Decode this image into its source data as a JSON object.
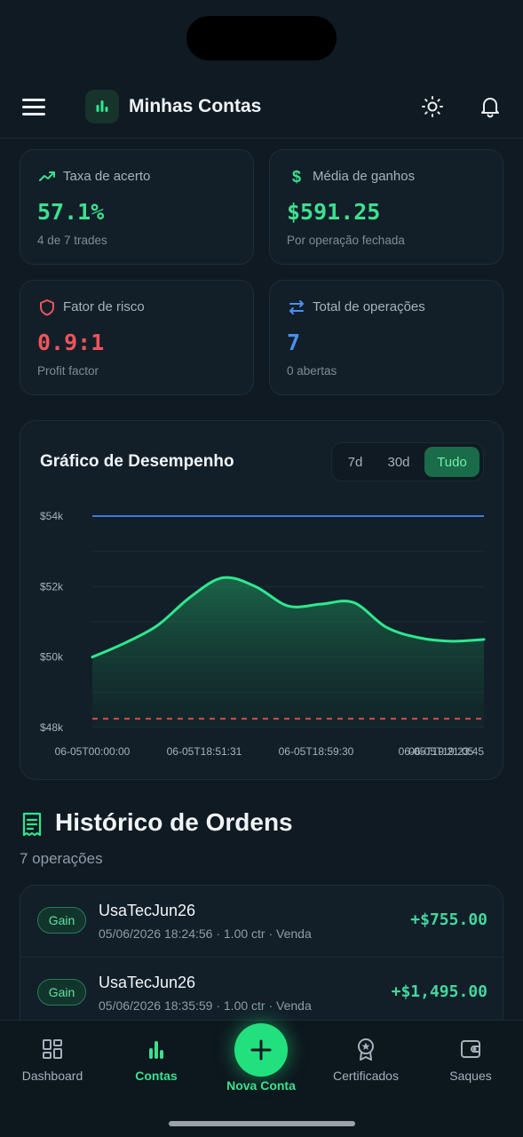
{
  "header": {
    "title": "Minhas Contas"
  },
  "stats": [
    {
      "label": "Taxa de acerto",
      "value": "57.1%",
      "sub": "4 de 7 trades",
      "color": "#3ee08e",
      "icon": "trend-up-icon"
    },
    {
      "label": "Média de ganhos",
      "value": "$591.25",
      "sub": "Por operação fechada",
      "color": "#3ee08e",
      "icon": "dollar-icon"
    },
    {
      "label": "Fator de risco",
      "value": "0.9:1",
      "sub": "Profit factor",
      "color": "#f0545a",
      "icon": "shield-icon"
    },
    {
      "label": "Total de operações",
      "value": "7",
      "sub": "0 abertas",
      "color": "#4a8ff0",
      "icon": "arrows-swap-icon"
    }
  ],
  "chart_card": {
    "title": "Gráfico de Desempenho",
    "ranges": [
      "7d",
      "30d",
      "Tudo"
    ],
    "active_range": "Tudo"
  },
  "chart_data": {
    "type": "area",
    "y_ticks": [
      "$54k",
      "$52k",
      "$50k",
      "$48k"
    ],
    "ylim": [
      48000,
      54000
    ],
    "x_ticks": [
      "06-05T00:00:00",
      "06-05T18:51:31",
      "06-05T18:59:30",
      "06-05T19:21:05",
      "06-05T19:23:45"
    ],
    "series": [
      {
        "values": [
          50000,
          50400,
          50900,
          51700,
          52250,
          52000,
          51450,
          51500,
          51550,
          50850,
          50550,
          50450,
          50500
        ],
        "color": "#2ee88d"
      }
    ],
    "reference_lines": [
      {
        "value": 54000,
        "style": "solid",
        "color": "#3b7be0"
      },
      {
        "value": 48250,
        "style": "dashed",
        "color": "#e04a4a"
      }
    ],
    "grid": true
  },
  "history": {
    "title": "Histórico de Ordens",
    "count": "7 operações",
    "orders": [
      {
        "badge": "Gain",
        "name": "UsaTecJun26",
        "meta": "05/06/2026 18:24:56 · 1.00 ctr · Venda",
        "amount": "+$755.00"
      },
      {
        "badge": "Gain",
        "name": "UsaTecJun26",
        "meta": "05/06/2026 18:35:59 · 1.00 ctr · Venda",
        "amount": "+$1,495.00"
      }
    ]
  },
  "nav": {
    "items": [
      {
        "label": "Dashboard",
        "icon": "dashboard-grid-icon"
      },
      {
        "label": "Contas",
        "icon": "bar-chart-icon"
      },
      {
        "label": "Certificados",
        "icon": "award-icon"
      },
      {
        "label": "Saques",
        "icon": "wallet-icon"
      }
    ],
    "fab_label": "Nova Conta",
    "active": "Contas"
  }
}
